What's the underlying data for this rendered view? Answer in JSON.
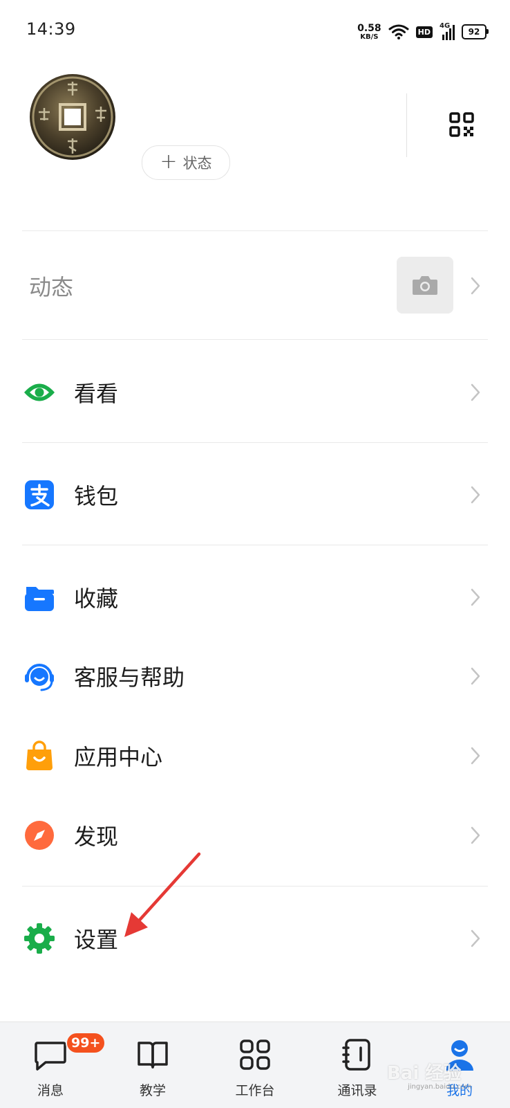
{
  "status_bar": {
    "time": "14:39",
    "net_speed_value": "0.58",
    "net_speed_unit": "KB/S",
    "hd_label": "HD",
    "network_label": "4G",
    "battery": "92"
  },
  "profile": {
    "status_button_label": "状态"
  },
  "moments": {
    "label": "动态"
  },
  "menu": [
    {
      "label": "看看",
      "icon": "eye-icon",
      "color": "#1aad4a"
    },
    {
      "label": "钱包",
      "icon": "alipay-wallet-icon",
      "color": "#1677ff"
    },
    {
      "label": "收藏",
      "icon": "folder-icon",
      "color": "#1677ff"
    },
    {
      "label": "客服与帮助",
      "icon": "headset-icon",
      "color": "#1677ff"
    },
    {
      "label": "应用中心",
      "icon": "shopping-bag-icon",
      "color": "#ff9f0a"
    },
    {
      "label": "发现",
      "icon": "compass-icon",
      "color": "#ff6a3d"
    },
    {
      "label": "设置",
      "icon": "gear-icon",
      "color": "#1aad4a"
    }
  ],
  "bottom_nav": [
    {
      "label": "消息",
      "icon": "chat-icon",
      "badge": "99+"
    },
    {
      "label": "教学",
      "icon": "book-icon"
    },
    {
      "label": "工作台",
      "icon": "workbench-grid-icon"
    },
    {
      "label": "通讯录",
      "icon": "contacts-book-icon"
    },
    {
      "label": "我的",
      "icon": "profile-person-icon",
      "active": true
    }
  ],
  "watermark": {
    "brand": "Bai 经验",
    "url": "jingyan.baidu.com"
  },
  "colors": {
    "accent": "#1a73e8",
    "annotation_arrow": "#e53935",
    "badge": "#f4511e"
  }
}
